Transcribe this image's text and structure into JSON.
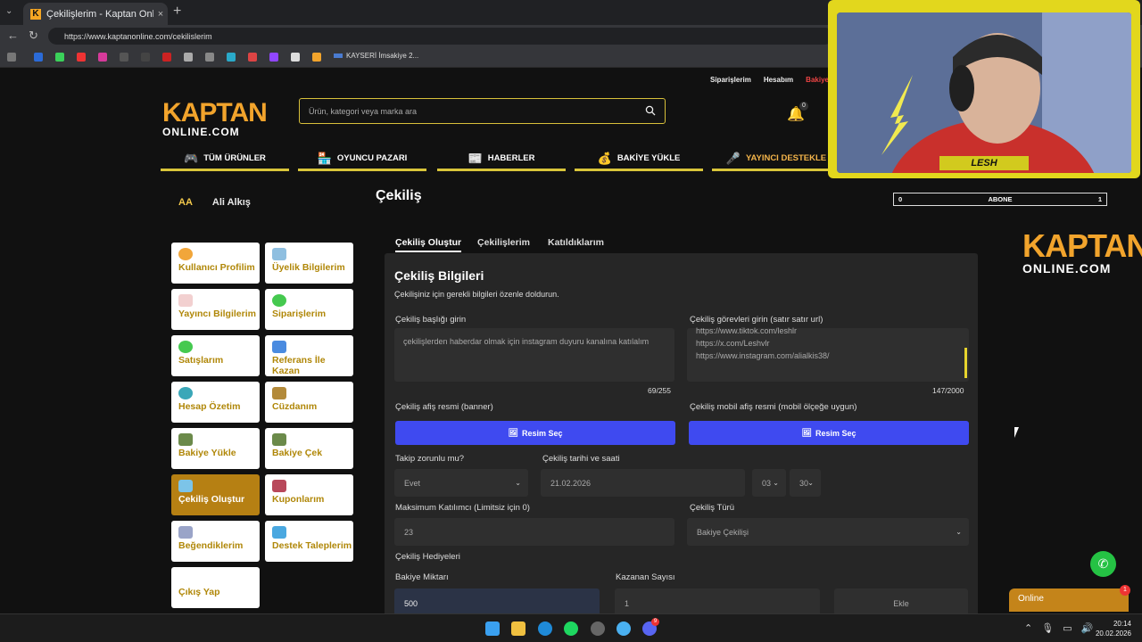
{
  "browser": {
    "tab_title": "Çekilişlerim - Kaptan Online",
    "url": "https://www.kaptanonline.com/cekilislerim",
    "bookmark_text": "KAYSERİ İmsakiye 2..."
  },
  "site": {
    "top_links": [
      "Siparişlerim",
      "Hesabım",
      "Bakiye Y..."
    ],
    "logo_top": "KAPTAN",
    "logo_bottom": "ONLINE.COM",
    "search_placeholder": "Ürün, kategori veya marka ara",
    "notif_count": "0",
    "nav": [
      "TÜM ÜRÜNLER",
      "OYUNCU PAZARI",
      "HABERLER",
      "BAKİYE YÜKLE",
      "YAYINCI DESTEKLE"
    ]
  },
  "user": {
    "initials": "AA",
    "name": "Ali Alkış"
  },
  "sidebar": {
    "items": [
      "Kullanıcı Profilim",
      "Üyelik Bilgilerim",
      "Yayıncı Bilgilerim",
      "Siparişlerim",
      "Satışlarım",
      "Referans İle Kazan",
      "Hesap Özetim",
      "Cüzdanım",
      "Bakiye Yükle",
      "Bakiye Çek",
      "Çekiliş Oluştur",
      "Kuponlarım",
      "Beğendiklerim",
      "Destek Taleplerim",
      "Çıkış Yap"
    ]
  },
  "main": {
    "heading": "Çekiliş",
    "tabs": [
      "Çekiliş Oluştur",
      "Çekilişlerim",
      "Katıldıklarım"
    ],
    "panel_title": "Çekiliş Bilgileri",
    "panel_subtitle": "Çekilişiniz için gerekli bilgileri özenle doldurun.",
    "title_label": "Çekiliş başlığı girin",
    "title_value": "çekilişlerden haberdar olmak için instagram duyuru kanalına katılalım",
    "title_count": "69/255",
    "tasks_label": "Çekiliş görevleri girin (satır satır url)",
    "tasks_lines": [
      "https://www.tiktok.com/leshlr",
      "https://x.com/Leshvlr",
      "https://www.instagram.com/alialkis38/"
    ],
    "tasks_count": "147/2000",
    "banner_label": "Çekiliş afiş resmi (banner)",
    "mobile_banner_label": "Çekiliş mobil afiş resmi (mobil ölçeğe uygun)",
    "choose_image": "Resim Seç",
    "follow_label": "Takip zorunlu mu?",
    "follow_value": "Evet",
    "date_label": "Çekiliş tarihi ve saati",
    "date_value": "21.02.2026",
    "hour_value": "03",
    "minute_value": "30",
    "max_label": "Maksimum Katılımcı (Limitsiz için 0)",
    "max_value": "23",
    "type_label": "Çekiliş Türü",
    "type_value": "Bakiye Çekilişi",
    "prizes_label": "Çekiliş Hediyeleri",
    "amount_label": "Bakiye Miktarı",
    "amount_value": "500",
    "winners_label": "Kazanan Sayısı",
    "winners_value": "1",
    "add_label": "Ekle"
  },
  "stream": {
    "name": "LESH",
    "abone_left": "0",
    "abone_label": "ABONE",
    "abone_right": "1",
    "side_logo_top": "KAPTAN",
    "side_logo_bottom": "ONLINE.COM"
  },
  "chat": {
    "label": "Online",
    "badge": "1"
  },
  "taskbar": {
    "time": "20:14",
    "date": "20.02.2026",
    "discord_badge": "9"
  },
  "colors": {
    "accent": "#f2a42c",
    "button": "#3f4af0",
    "active_card": "#b68013",
    "nav_underline": "#d9c53a"
  }
}
